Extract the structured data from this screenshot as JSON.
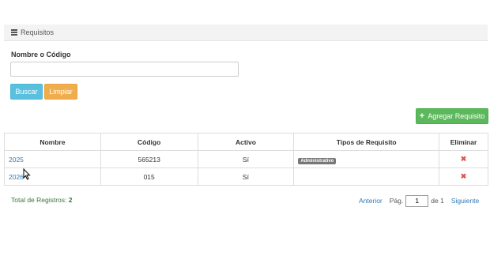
{
  "panel": {
    "title": "Requisitos"
  },
  "filter": {
    "label": "Nombre o Código",
    "value": "",
    "placeholder": ""
  },
  "buttons": {
    "search": "Buscar",
    "clear": "Limpiar",
    "add": "Agregar Requisito"
  },
  "table": {
    "headers": [
      "Nombre",
      "Código",
      "Activo",
      "Tipos de Requisito",
      "Eliminar"
    ],
    "rows": [
      {
        "nombre": "2025",
        "codigo": "565213",
        "activo": "Sí",
        "tipo": "Administrativo",
        "delete": "✖"
      },
      {
        "nombre": "2026",
        "codigo": "015",
        "activo": "Sí",
        "tipo": "",
        "delete": "✖"
      }
    ]
  },
  "footer": {
    "total_label": "Total de Registros:",
    "total_value": "2"
  },
  "pagination": {
    "prev": "Anterior",
    "page_label": "Pág.",
    "page_value": "1",
    "of_label": "de 1",
    "next": "Siguiente"
  },
  "icons": {
    "panel": "list-icon",
    "add": "plus-icon",
    "delete": "close-icon",
    "cursor": "mouse-cursor-icon"
  },
  "colors": {
    "info": "#5bc0de",
    "warning": "#f0ad4e",
    "success": "#5cb85c",
    "link": "#337ab7",
    "danger": "#d9534f",
    "total": "#3c763d"
  }
}
